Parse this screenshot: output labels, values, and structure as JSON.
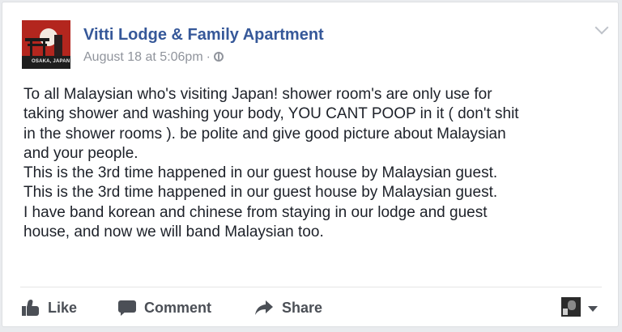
{
  "post": {
    "author": "Vitti Lodge & Family Apartment",
    "timestamp": "August 18 at 5:06pm",
    "separator": "·",
    "avatar_caption": "OSAKA, JAPAN",
    "lines": [
      "To all Malaysian who's visiting Japan! shower room's are only use for",
      "taking shower and washing your body, YOU CANT POOP in it ( don't shit",
      "in the shower rooms ). be polite and give good picture about Malaysian",
      "and your people.",
      "This is the 3rd time happened in our guest house by Malaysian guest.",
      "This is the 3rd time happened in our guest house by Malaysian guest.",
      "I have band korean and chinese from staying in our lodge and guest",
      "house, and now we will band Malaysian too."
    ]
  },
  "actions": {
    "like": "Like",
    "comment": "Comment",
    "share": "Share"
  },
  "icons": {
    "privacy": "globe-icon",
    "options": "chevron-down-icon",
    "like": "thumbs-up-icon",
    "comment": "comment-bubble-icon",
    "share": "share-arrow-icon",
    "viewer": "viewer-avatar",
    "viewer_menu": "caret-down-icon"
  },
  "colors": {
    "link": "#365899",
    "meta": "#90949c",
    "text": "#1d2129",
    "action": "#4b4f56"
  }
}
